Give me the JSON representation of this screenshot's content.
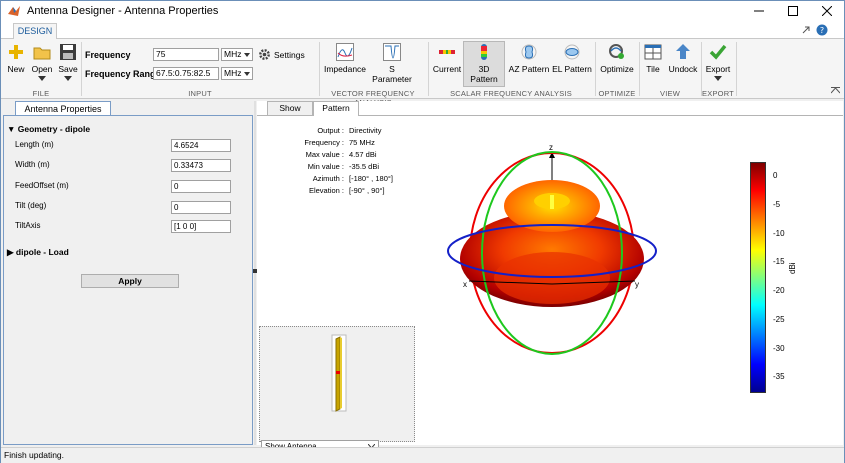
{
  "window": {
    "title": "Antenna Designer - Antenna Properties"
  },
  "ribbon_tab": "DESIGN",
  "file_group": {
    "label": "FILE",
    "new": "New",
    "open": "Open",
    "save": "Save"
  },
  "input_group": {
    "label": "INPUT",
    "frequency_label": "Frequency",
    "frequency_value": "75",
    "frequency_unit": "MHz",
    "range_label": "Frequency Range",
    "range_value": "67.5:0.75:82.5",
    "range_unit": "MHz",
    "settings": "Settings"
  },
  "vfa_group": {
    "label": "VECTOR FREQUENCY ANALYSIS",
    "impedance": "Impedance",
    "sparam": "S Parameter"
  },
  "sfa_group": {
    "label": "SCALAR FREQUENCY ANALYSIS",
    "current": "Current",
    "pattern3d": "3D Pattern",
    "az": "AZ Pattern",
    "el": "EL Pattern"
  },
  "optimize_group": {
    "label": "OPTIMIZE",
    "optimize": "Optimize"
  },
  "view_group": {
    "label": "VIEW",
    "tile": "Tile",
    "undock": "Undock"
  },
  "export_group": {
    "label": "EXPORT",
    "export": "Export"
  },
  "left_panel": {
    "tab": "Antenna Properties",
    "geometry_header": "Geometry - dipole",
    "properties": [
      {
        "label": "Length (m)",
        "value": "4.6524"
      },
      {
        "label": "Width (m)",
        "value": "0.33473"
      },
      {
        "label": "FeedOffset (m)",
        "value": "0"
      },
      {
        "label": "Tilt (deg)",
        "value": "0"
      },
      {
        "label": "TiltAxis",
        "value": "[1 0 0]"
      }
    ],
    "load_header": "dipole - Load",
    "apply": "Apply"
  },
  "right_panel": {
    "tabs": [
      "Show",
      "Pattern"
    ],
    "info": [
      {
        "k": "Output :",
        "v": "Directivity"
      },
      {
        "k": "Frequency :",
        "v": "75 MHz"
      },
      {
        "k": "Max value :",
        "v": "4.57 dBi"
      },
      {
        "k": "Min value :",
        "v": "-35.5 dBi"
      },
      {
        "k": "Azimuth :",
        "v": "[-180° , 180°]"
      },
      {
        "k": "Elevation :",
        "v": "[-90° , 90°]"
      }
    ],
    "axis_x": "x",
    "axis_y": "y",
    "axis_z": "z",
    "colorbar_ticks": [
      "0",
      "-5",
      "-10",
      "-15",
      "-20",
      "-25",
      "-30",
      "-35"
    ],
    "colorbar_label": "dBi",
    "show_select": "Show Antenna"
  },
  "status": "Finish updating."
}
